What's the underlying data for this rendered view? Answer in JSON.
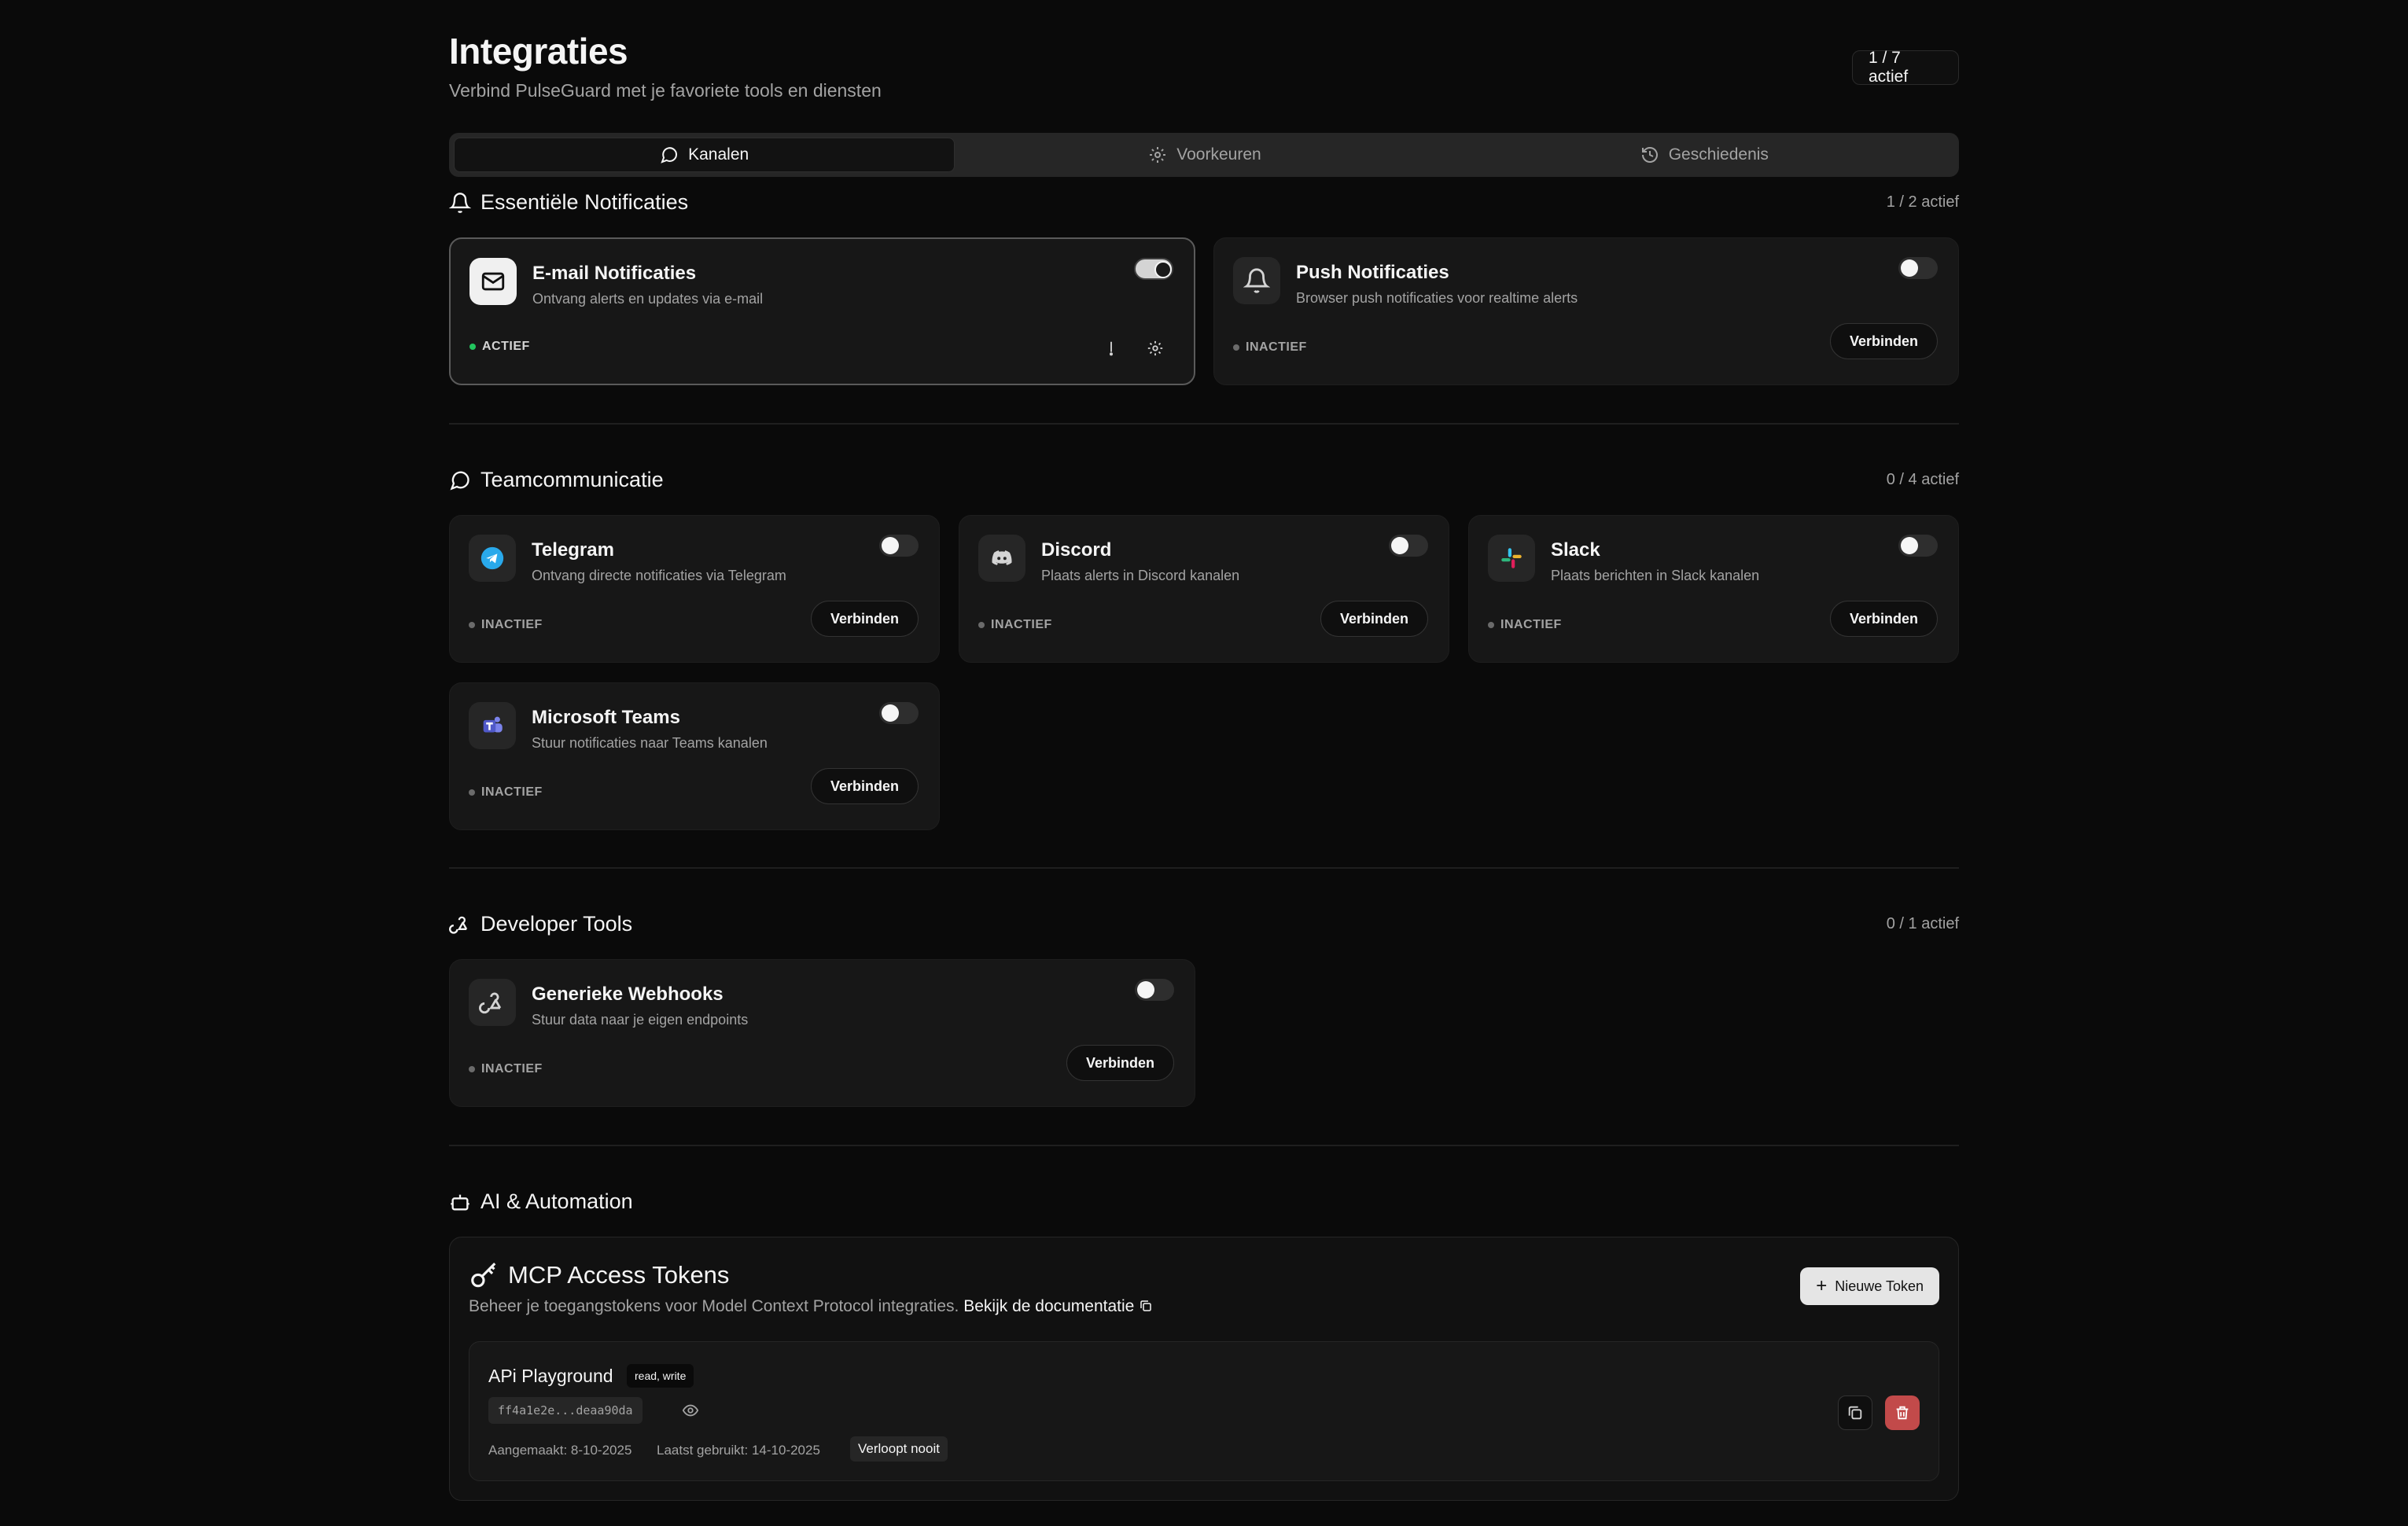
{
  "header": {
    "title": "Integraties",
    "subtitle": "Verbind PulseGuard met je favoriete tools en diensten",
    "active_count": "1 / 7 actief"
  },
  "tabs": [
    {
      "label": "Kanalen",
      "icon": "message-circle-icon",
      "active": true
    },
    {
      "label": "Voorkeuren",
      "icon": "gear-icon",
      "active": false
    },
    {
      "label": "Geschiedenis",
      "icon": "history-icon",
      "active": false
    }
  ],
  "sections": {
    "essential": {
      "title": "Essentiële Notificaties",
      "count": "1 / 2 actief",
      "cards": [
        {
          "name": "E-mail Notificaties",
          "desc": "Ontvang alerts en updates via e-mail",
          "status": "ACTIEF",
          "on": true,
          "icon": "mail-icon"
        },
        {
          "name": "Push Notificaties",
          "desc": "Browser push notificaties voor realtime alerts",
          "status": "INACTIEF",
          "on": false,
          "icon": "bell-icon",
          "button": "Verbinden"
        }
      ]
    },
    "team": {
      "title": "Teamcommunicatie",
      "count": "0 / 4 actief",
      "cards": [
        {
          "name": "Telegram",
          "desc": "Ontvang directe notificaties via Telegram",
          "status": "INACTIEF",
          "on": false,
          "icon": "telegram-icon",
          "button": "Verbinden"
        },
        {
          "name": "Discord",
          "desc": "Plaats alerts in Discord kanalen",
          "status": "INACTIEF",
          "on": false,
          "icon": "discord-icon",
          "button": "Verbinden"
        },
        {
          "name": "Slack",
          "desc": "Plaats berichten in Slack kanalen",
          "status": "INACTIEF",
          "on": false,
          "icon": "slack-icon",
          "button": "Verbinden"
        },
        {
          "name": "Microsoft Teams",
          "desc": "Stuur notificaties naar Teams kanalen",
          "status": "INACTIEF",
          "on": false,
          "icon": "teams-icon",
          "button": "Verbinden"
        }
      ]
    },
    "dev": {
      "title": "Developer Tools",
      "count": "0 / 1 actief",
      "cards": [
        {
          "name": "Generieke Webhooks",
          "desc": "Stuur data naar je eigen endpoints",
          "status": "INACTIEF",
          "on": false,
          "icon": "webhook-icon",
          "button": "Verbinden"
        }
      ]
    },
    "ai": {
      "title": "AI & Automation"
    }
  },
  "mcp": {
    "title": "MCP Access Tokens",
    "subtitle": "Beheer je toegangstokens voor Model Context Protocol integraties.",
    "doc_link": "Bekijk de documentatie",
    "new_token": "Nieuwe Token",
    "token": {
      "name": "APi Playground",
      "scope": "read, write",
      "value": "ff4a1e2e...deaa90da",
      "created": "Aangemaakt: 8-10-2025",
      "last_used": "Laatst gebruikt: 14-10-2025",
      "expires": "Verloopt nooit"
    }
  },
  "colors": {
    "background": "#0a0a0a",
    "card": "#171717",
    "active_dot": "#22c55e",
    "delete": "#c24a4a"
  }
}
